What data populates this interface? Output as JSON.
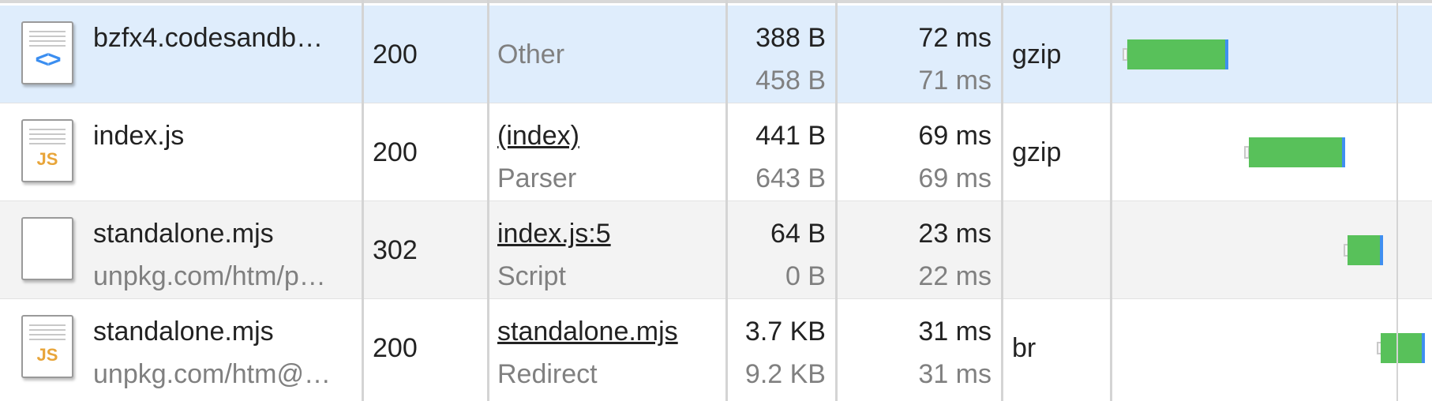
{
  "requests": [
    {
      "name": "bzfx4.codesandb…",
      "domain": "",
      "icon": "document-icon",
      "status": "200",
      "initiator": "Other",
      "initiator_type": "",
      "transferred": "388 B",
      "resource_size": "458 B",
      "time": "72 ms",
      "latency": "71 ms",
      "encoding": "gzip",
      "waterfall": {
        "start": 0.02,
        "width": 0.28
      },
      "selected": true
    },
    {
      "name": "index.js",
      "domain": "",
      "icon": "js-file-icon",
      "status": "200",
      "initiator": "(index)",
      "initiator_type": "Parser",
      "transferred": "441 B",
      "resource_size": "643 B",
      "time": "69 ms",
      "latency": "69 ms",
      "encoding": "gzip",
      "waterfall": {
        "start": 0.36,
        "width": 0.26
      },
      "selected": false
    },
    {
      "name": "standalone.mjs",
      "domain": "unpkg.com/htm/p…",
      "icon": "blank-file-icon",
      "status": "302",
      "initiator": "index.js:5",
      "initiator_type": "Script",
      "transferred": "64 B",
      "resource_size": "0 B",
      "time": "23 ms",
      "latency": "22 ms",
      "encoding": "",
      "waterfall": {
        "start": 0.63,
        "width": 0.09
      },
      "selected": false
    },
    {
      "name": "standalone.mjs",
      "domain": "unpkg.com/htm@…",
      "icon": "js-file-icon",
      "status": "200",
      "initiator": "standalone.mjs",
      "initiator_type": "Redirect",
      "transferred": "3.7 KB",
      "resource_size": "9.2 KB",
      "time": "31 ms",
      "latency": "31 ms",
      "encoding": "br",
      "waterfall": {
        "start": 0.73,
        "width": 0.12
      },
      "selected": false
    }
  ],
  "icon_glyphs": {
    "js": "JS",
    "doc": "<>"
  },
  "colors": {
    "selected_row": "#dfedfc",
    "waterfall_bar": "#58c15a",
    "waterfall_receive": "#3f8ff0",
    "link_text": "#222222",
    "secondary_text": "#808080"
  }
}
